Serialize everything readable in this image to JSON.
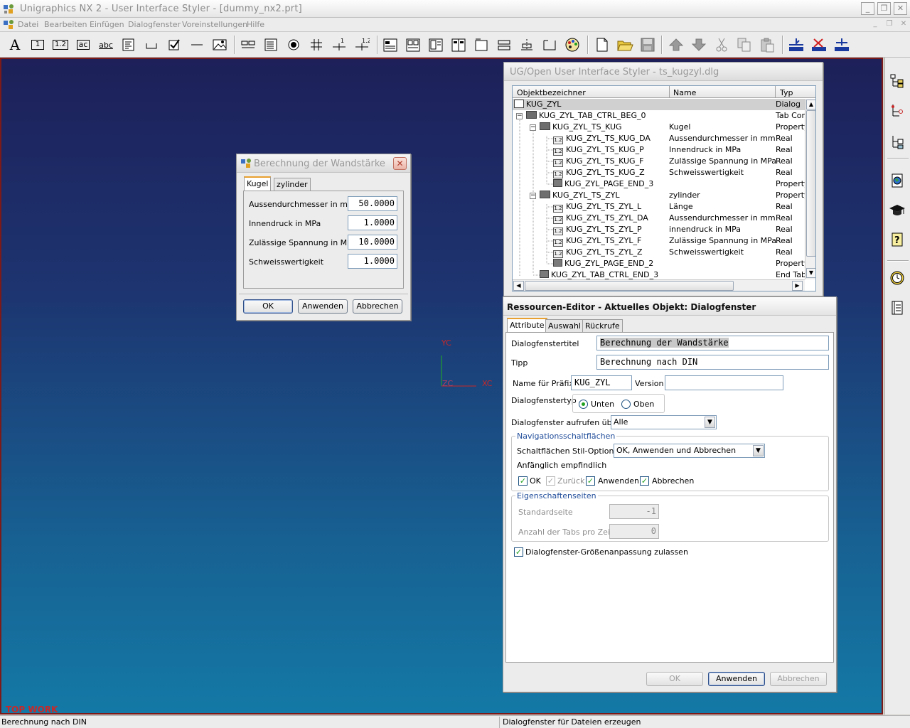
{
  "window": {
    "title": "Unigraphics NX 2 - User Interface Styler - [dummy_nx2.prt]",
    "menu": [
      "Datei",
      "Bearbeiten",
      "Einfügen",
      "Dialogfenster",
      "Voreinstellungen",
      "Hilfe"
    ]
  },
  "toolbar": {
    "text_tool_label": "A",
    "int_tool_label": "1",
    "real_tool_label": "1.2",
    "string_tool_label": "ac",
    "label_tool_label": "abc"
  },
  "viewport": {
    "axis_yc": "YC",
    "axis_xc": "XC",
    "axis_zc": "ZC",
    "wcs_label": "TOP WORK"
  },
  "preview_dialog": {
    "title": "Berechnung der Wandstärke",
    "tabs": [
      "Kugel",
      "zylinder"
    ],
    "fields": [
      {
        "label": "Aussendurchmesser in mm",
        "value": "50.0000"
      },
      {
        "label": "Innendruck in MPa",
        "value": "1.0000"
      },
      {
        "label": "Zulässige Spannung in MPa",
        "value": "10.0000"
      },
      {
        "label": "Schweisswertigkeit",
        "value": "1.0000"
      }
    ],
    "buttons": {
      "ok": "OK",
      "apply": "Anwenden",
      "cancel": "Abbrechen"
    }
  },
  "styler": {
    "title": "UG/Open User Interface Styler - ts_kugzyl.dlg",
    "columns": [
      "Objektbezeichner",
      "Name",
      "Typ"
    ],
    "rows": [
      {
        "id": "KUG_ZYL",
        "name": "",
        "type": "Dialog"
      },
      {
        "id": "KUG_ZYL_TAB_CTRL_BEG_0",
        "name": "",
        "type": "Tab Con"
      },
      {
        "id": "KUG_ZYL_TS_KUG",
        "name": "Kugel",
        "type": "Property"
      },
      {
        "id": "KUG_ZYL_TS_KUG_DA",
        "name": "Aussendurchmesser in mm",
        "type": "Real"
      },
      {
        "id": "KUG_ZYL_TS_KUG_P",
        "name": "Innendruck in MPa",
        "type": "Real"
      },
      {
        "id": "KUG_ZYL_TS_KUG_F",
        "name": "Zulässige Spannung in MPa",
        "type": "Real"
      },
      {
        "id": "KUG_ZYL_TS_KUG_Z",
        "name": "Schweisswertigkeit",
        "type": "Real"
      },
      {
        "id": "KUG_ZYL_PAGE_END_3",
        "name": "",
        "type": "Property"
      },
      {
        "id": "KUG_ZYL_TS_ZYL",
        "name": "zylinder",
        "type": "Property"
      },
      {
        "id": "KUG_ZYL_TS_ZYL_L",
        "name": "Länge",
        "type": "Real"
      },
      {
        "id": "KUG_ZYL_TS_ZYL_DA",
        "name": "Aussendurchmesser in mm",
        "type": "Real"
      },
      {
        "id": "KUG_ZYL_TS_ZYL_P",
        "name": "innendruck in MPa",
        "type": "Real"
      },
      {
        "id": "KUG_ZYL_TS_ZYL_F",
        "name": "Zulässige Spannung in MPa",
        "type": "Real"
      },
      {
        "id": "KUG_ZYL_TS_ZYL_Z",
        "name": "Schweisswertigkeit",
        "type": "Real"
      },
      {
        "id": "KUG_ZYL_PAGE_END_2",
        "name": "",
        "type": "Property"
      },
      {
        "id": "KUG_ZYL_TAB_CTRL_END_3",
        "name": "",
        "type": "End Tab"
      }
    ],
    "real_icon_text": "1.2"
  },
  "resource_editor": {
    "title": "Ressourcen-Editor - Aktuelles Objekt: Dialogfenster",
    "tabs": [
      "Attribute",
      "Auswahl",
      "Rückrufe"
    ],
    "dialog_title_label": "Dialogfenstertitel",
    "dialog_title_value": "Berechnung der Wandstärke",
    "tip_label": "Tipp",
    "tip_value": "Berechnung nach DIN",
    "prefix_label": "Name für Präfix",
    "prefix_value": "KUG_ZYL",
    "version_label": "Version",
    "version_value": "",
    "dialog_type_label": "Dialogfenstertyp",
    "dialog_type_options": [
      "Unten",
      "Oben"
    ],
    "invoke_label": "Dialogfenster aufrufen über",
    "invoke_value": "Alle",
    "nav_group_title": "Navigationsschaltflächen",
    "button_style_label": "Schaltflächen Stil-Optionen",
    "button_style_value": "OK, Anwenden und Abbrechen",
    "initially_sensitive_label": "Anfänglich empfindlich",
    "nav_checks": [
      {
        "label": "OK",
        "checked": true,
        "enabled": true
      },
      {
        "label": "Zurück",
        "checked": true,
        "enabled": false
      },
      {
        "label": "Anwenden",
        "checked": true,
        "enabled": true
      },
      {
        "label": "Abbrechen",
        "checked": true,
        "enabled": true
      }
    ],
    "props_group_title": "Eigenschaftenseiten",
    "default_page_label": "Standardseite",
    "default_page_value": "-1",
    "tabs_per_row_label": "Anzahl der Tabs pro Zeile",
    "tabs_per_row_value": "0",
    "resize_label": "Dialogfenster-Größenanpassung zulassen",
    "buttons": {
      "ok": "OK",
      "apply": "Anwenden",
      "cancel": "Abbrechen"
    }
  },
  "status": {
    "left": "Berechnung nach DIN",
    "right": "Dialogfenster für Dateien erzeugen"
  }
}
